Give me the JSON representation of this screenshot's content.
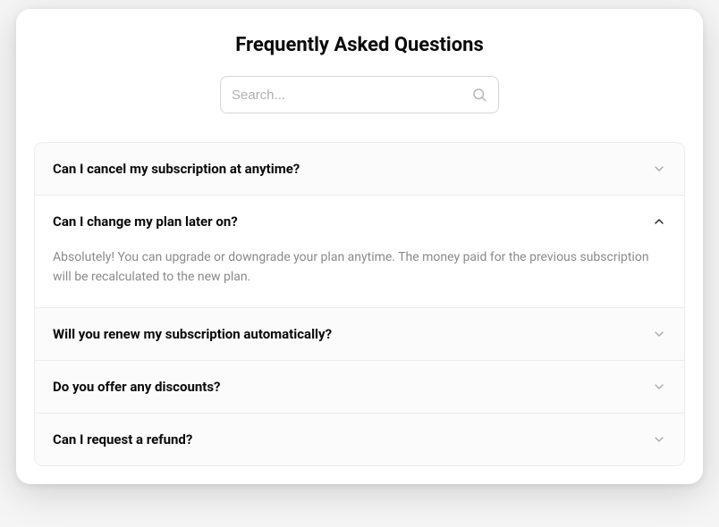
{
  "title": "Frequently Asked Questions",
  "search": {
    "placeholder": "Search..."
  },
  "faq": [
    {
      "question": "Can I cancel my subscription at anytime?",
      "expanded": false
    },
    {
      "question": "Can I change my plan later on?",
      "expanded": true,
      "answer": "Absolutely! You can upgrade or downgrade your plan anytime. The money paid for the previous subscription will be recalculated to the new plan."
    },
    {
      "question": "Will you renew my subscription automatically?",
      "expanded": false
    },
    {
      "question": "Do you offer any discounts?",
      "expanded": false
    },
    {
      "question": "Can I request a refund?",
      "expanded": false
    }
  ]
}
